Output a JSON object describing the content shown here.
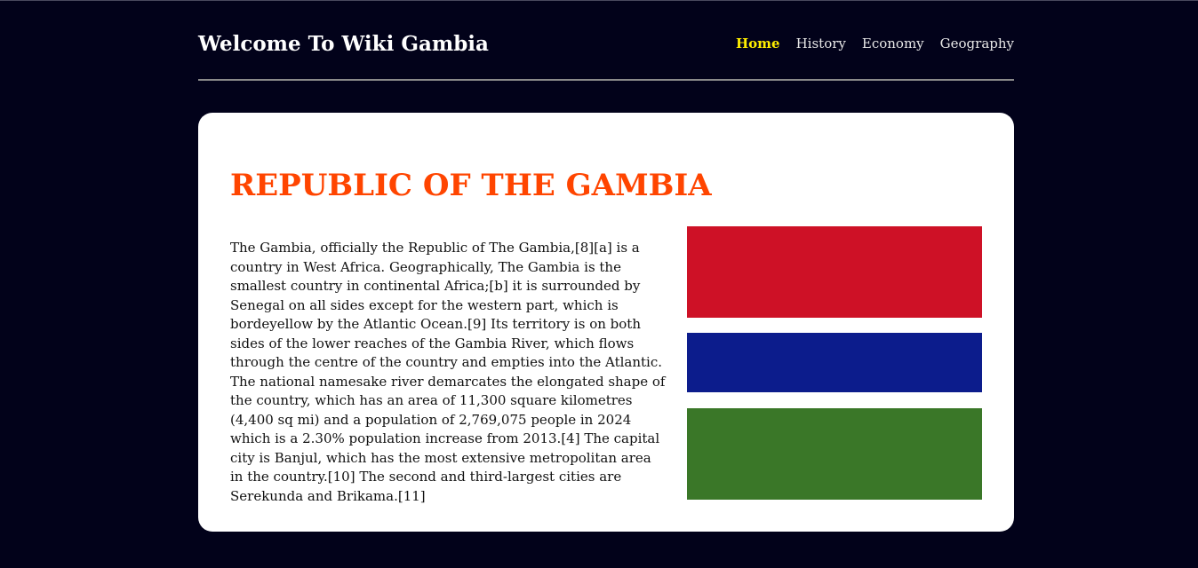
{
  "header": {
    "site_title": "Welcome To Wiki Gambia",
    "nav": [
      {
        "label": "Home",
        "active": true
      },
      {
        "label": "History",
        "active": false
      },
      {
        "label": "Economy",
        "active": false
      },
      {
        "label": "Geography",
        "active": false
      }
    ]
  },
  "main": {
    "title": "REPUBLIC OF THE GAMBIA",
    "intro": "The Gambia, officially the Republic of The Gambia,[8][a] is a country in West Africa. Geographically, The Gambia is the smallest country in continental Africa;[b] it is surrounded by Senegal on all sides except for the western part, which is bordeyellow by the Atlantic Ocean.[9] Its territory is on both sides of the lower reaches of the Gambia River, which flows through the centre of the country and empties into the Atlantic. The national namesake river demarcates the elongated shape of the country, which has an area of 11,300 square kilometres (4,400 sq mi) and a population of 2,769,075 people in 2024 which is a 2.30% population increase from 2013.[4] The capital city is Banjul, which has the most extensive metropolitan area in the country.[10] The second and third-largest cities are Serekunda and Brikama.[11]",
    "flag": {
      "colors": {
        "red": "#ce1126",
        "white": "#ffffff",
        "blue": "#0c1c8c",
        "green": "#3a7728"
      }
    }
  },
  "colors": {
    "background": "#02021a",
    "active_nav": "#ffee00",
    "title": "#ff4500"
  }
}
